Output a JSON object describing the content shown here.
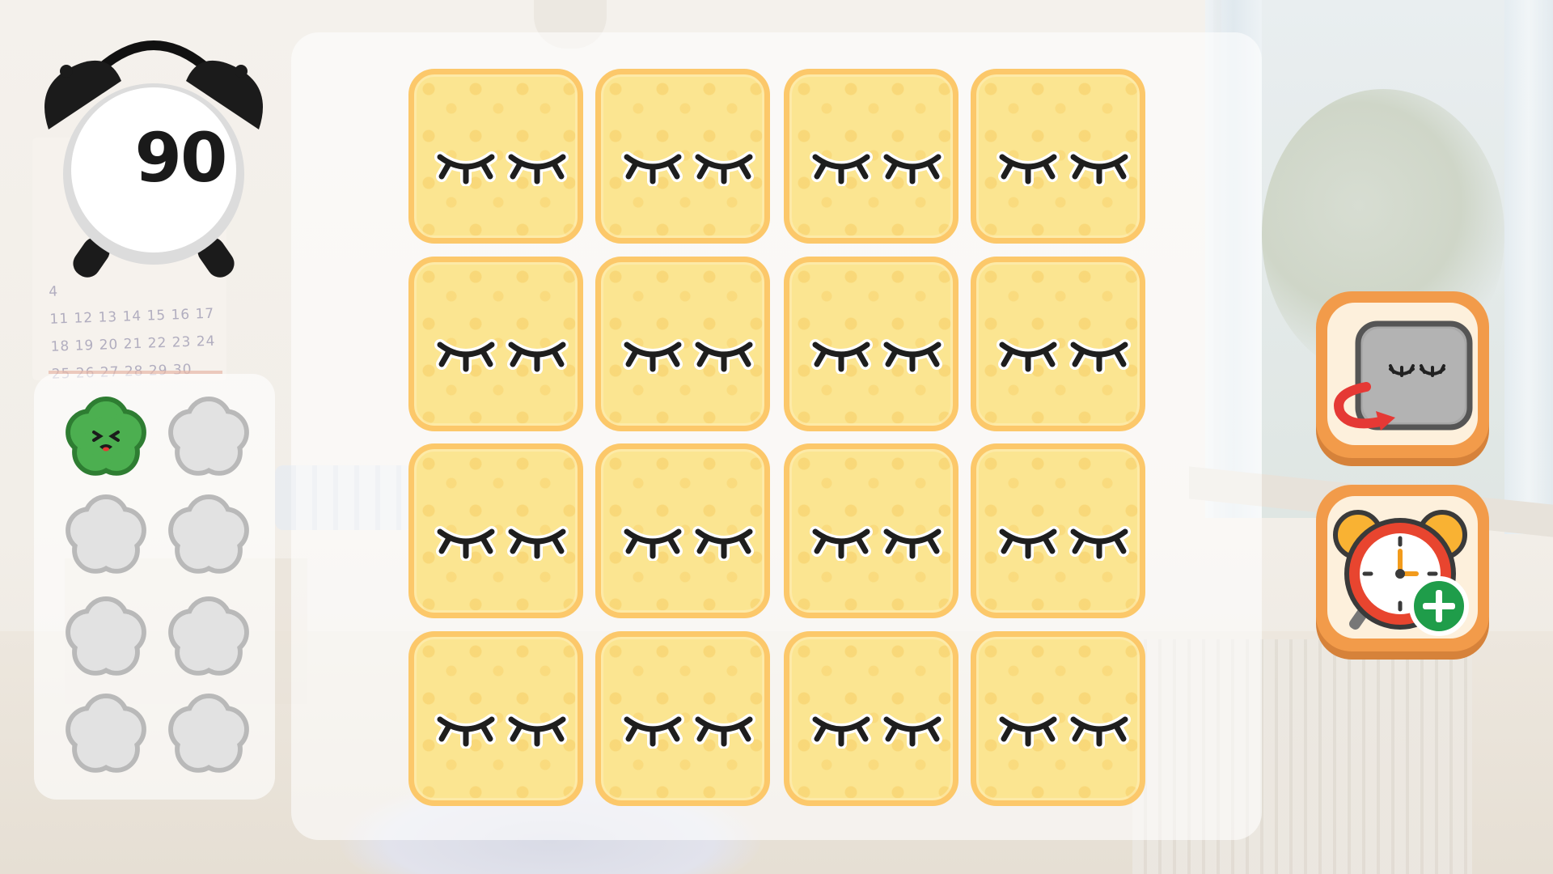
{
  "timer": {
    "value": "90",
    "icon": "alarm-clock-icon"
  },
  "stars": {
    "total": 8,
    "earned": [
      {
        "state": "earned",
        "color": "#4caf50",
        "face": "angry-face-icon"
      },
      {
        "state": "empty"
      },
      {
        "state": "empty"
      },
      {
        "state": "empty"
      },
      {
        "state": "empty"
      },
      {
        "state": "empty"
      },
      {
        "state": "empty"
      },
      {
        "state": "empty"
      }
    ]
  },
  "board": {
    "rows": 4,
    "cols": 4,
    "card_state": "face-down",
    "card_face": "sleeping-eyes-icon",
    "card_color": "#fbe591",
    "card_border": "#fcc86a"
  },
  "powerups": [
    {
      "name": "flip-card-powerup",
      "icon": "flip-card-icon"
    },
    {
      "name": "add-time-powerup",
      "icon": "alarm-clock-plus-icon"
    }
  ],
  "background": {
    "calendar_numbers": "4\n11 12 13 14 15 16 17\n18 19 20 21 22 23 24\n25 26 27 28 29 30"
  },
  "colors": {
    "accent_orange": "#f29b4a",
    "card_yellow": "#fbe591",
    "star_green": "#4caf50",
    "star_empty": "#e2e2e2"
  }
}
